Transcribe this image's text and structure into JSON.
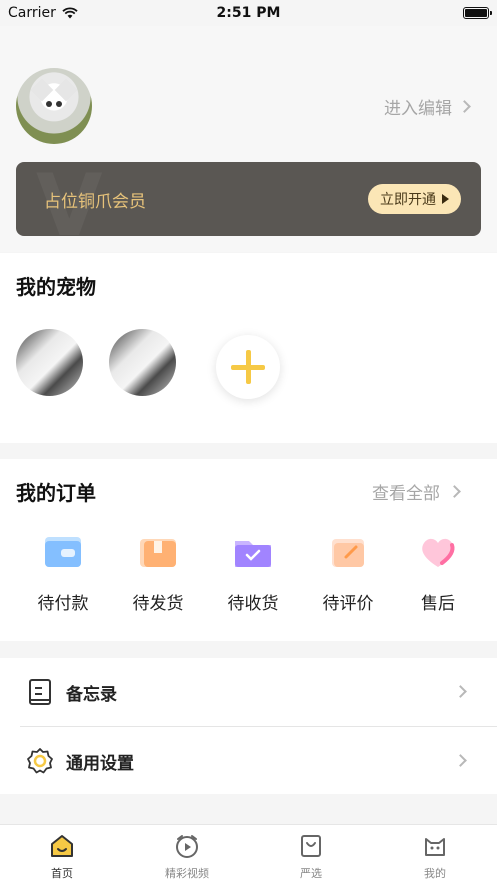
{
  "status_bar": {
    "carrier": "Carrier",
    "time": "2:51 PM"
  },
  "profile": {
    "edit_label": "进入编辑"
  },
  "vip": {
    "text": "占位铜爪会员",
    "button": "立即开通"
  },
  "pets": {
    "title": "我的宠物"
  },
  "orders": {
    "title": "我的订单",
    "view_all": "查看全部",
    "items": [
      {
        "label": "待付款",
        "icon": "wallet-icon"
      },
      {
        "label": "待发货",
        "icon": "package-icon"
      },
      {
        "label": "待收货",
        "icon": "folder-check-icon"
      },
      {
        "label": "待评价",
        "icon": "review-pen-icon"
      },
      {
        "label": "售后",
        "icon": "heart-icon"
      }
    ]
  },
  "menu": [
    {
      "label": "备忘录",
      "icon": "notebook-icon"
    },
    {
      "label": "通用设置",
      "icon": "gear-icon"
    }
  ],
  "tabbar": {
    "active_index": 0,
    "items": [
      {
        "label": "首页",
        "icon": "home-icon"
      },
      {
        "label": "精彩视频",
        "icon": "video-icon"
      },
      {
        "label": "严选",
        "icon": "shopping-bag-icon"
      },
      {
        "label": "我的",
        "icon": "cat-face-icon"
      }
    ]
  },
  "colors": {
    "accent": "#f6c945",
    "vip_bg": "#5a5753",
    "vip_text": "#e6c27a",
    "vip_button": "#fbe6b6"
  }
}
